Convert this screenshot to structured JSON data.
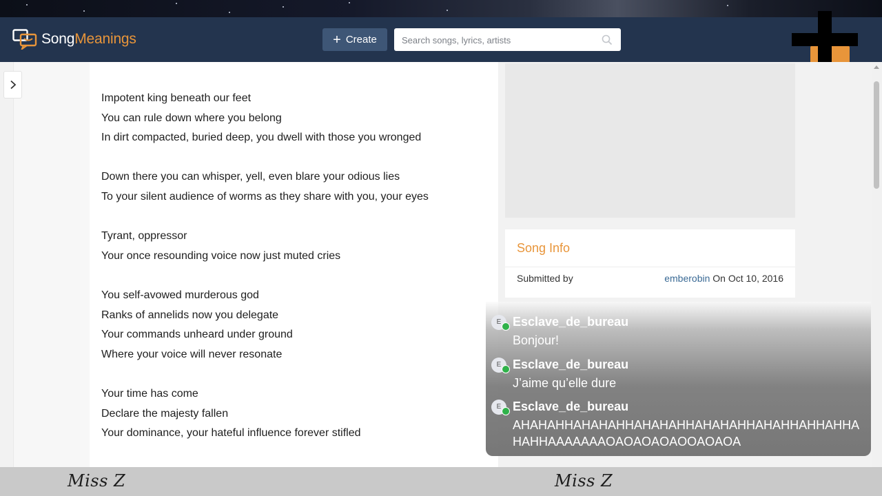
{
  "brand": {
    "name_part1": "Song",
    "name_part2": "Meanings",
    "accent_color": "#e8953a",
    "nav_color": "#23344e"
  },
  "header": {
    "create_label": "Create",
    "search_placeholder": "Search songs, lyrics, artists"
  },
  "lyrics": {
    "stanzas": [
      [
        "Impotent king beneath our feet",
        "You can rule down where you belong",
        "In dirt compacted, buried deep, you dwell with those you wronged"
      ],
      [
        "Down there you can whisper, yell, even blare your odious lies",
        "To your silent audience of worms as they share with you, your eyes"
      ],
      [
        "Tyrant, oppressor",
        "Your once resounding voice now just muted cries"
      ],
      [
        "You self-avowed murderous god",
        "Ranks of annelids now you delegate",
        "Your commands unheard under ground",
        "Where your voice will never resonate"
      ],
      [
        "Your time has come",
        "Declare the majesty fallen",
        "Your dominance, your hateful influence forever stifled"
      ]
    ]
  },
  "song_info": {
    "title": "Song Info",
    "submitted_label": "Submitted by",
    "submitter": "emberobin",
    "submitted_on": "On Oct 10, 2016"
  },
  "chat": {
    "messages": [
      {
        "avatar_letter": "E",
        "author": "Esclave_de_bureau",
        "text": "Bonjour!"
      },
      {
        "avatar_letter": "E",
        "author": "Esclave_de_bureau",
        "text": "J’aime qu’elle dure"
      },
      {
        "avatar_letter": "E",
        "author": "Esclave_de_bureau",
        "text": "AHAHAHHAHAHAHHAHAHAHHAHAHAHHAHAHHAHHAHHAHAHHAAAAAAAOAOAOAOAOOAOAOA"
      }
    ]
  },
  "watermark": {
    "left": "Miss Z",
    "right": "Miss Z"
  }
}
